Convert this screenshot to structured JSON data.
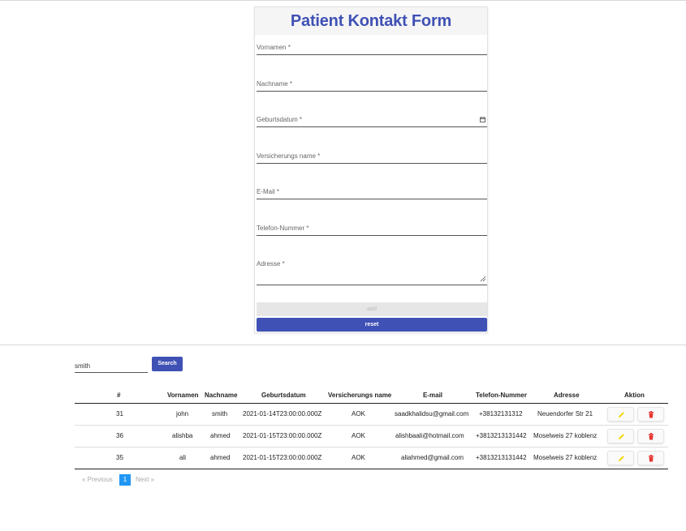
{
  "form": {
    "title": "Patient Kontakt Form",
    "fields": [
      {
        "label": "Vornamen *",
        "value": ""
      },
      {
        "label": "Nachname *",
        "value": ""
      },
      {
        "label": "Geburtsdatum *",
        "value": ""
      },
      {
        "label": "Versicherungs name *",
        "value": ""
      },
      {
        "label": "E-Mail *",
        "value": ""
      },
      {
        "label": "Telefon-Nummer *",
        "value": ""
      },
      {
        "label": "Adresse *",
        "value": ""
      }
    ],
    "add_label": "add",
    "reset_label": "reset"
  },
  "search": {
    "value": "smith",
    "button_label": "Search"
  },
  "table": {
    "headers": [
      "#",
      "Vornamen",
      "Nachname",
      "Geburtsdatum",
      "Versicherungs name",
      "E-mail",
      "Telefon-Nummer",
      "Adresse",
      "Aktion"
    ],
    "rows": [
      {
        "id": "31",
        "vornamen": "john",
        "nachname": "smith",
        "geburtsdatum": "2021-01-14T23:00:00.000Z",
        "versicherung": "AOK",
        "email": "saadkhalidsu@gmail.com",
        "telefon": "+38132131312",
        "adresse": "Neuendorfer Str 21"
      },
      {
        "id": "36",
        "vornamen": "alishba",
        "nachname": "ahmed",
        "geburtsdatum": "2021-01-15T23:00:00.000Z",
        "versicherung": "AOK",
        "email": "alishbaali@hotmail.com",
        "telefon": "+3813213131442",
        "adresse": "Moselweis 27 koblenz"
      },
      {
        "id": "35",
        "vornamen": "ali",
        "nachname": "ahmed",
        "geburtsdatum": "2021-01-15T23:00:00.000Z",
        "versicherung": "AOK",
        "email": "aliahmed@gmail.com",
        "telefon": "+3813213131442",
        "adresse": "Moselweis 27 koblenz"
      }
    ],
    "edit_icon": "pencil-icon",
    "delete_icon": "trash-icon",
    "edit_color": "#f2d600",
    "delete_color": "#e53935"
  },
  "pagination": {
    "previous_label": "« Previous",
    "current_page": "1",
    "next_label": "Next »"
  },
  "colors": {
    "primary": "#3f51b5",
    "page_active": "#2196f3"
  }
}
